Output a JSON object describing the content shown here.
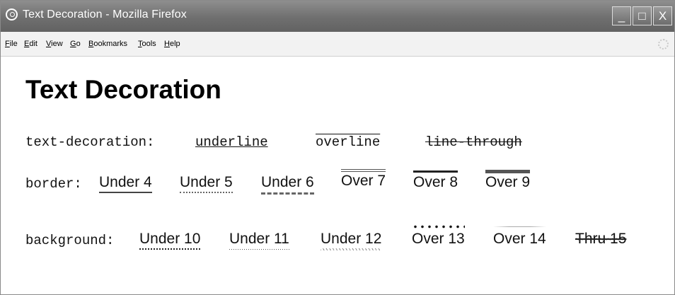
{
  "window": {
    "title": "Text Decoration - Mozilla Firefox",
    "buttons": {
      "minimize": "_",
      "maximize": "□",
      "close": "X"
    }
  },
  "menu": [
    {
      "label": "File",
      "accel": "F",
      "rest": "ile"
    },
    {
      "label": "Edit",
      "accel": "E",
      "rest": "dit"
    },
    {
      "label": "View",
      "accel": "V",
      "rest": "iew"
    },
    {
      "label": "Go",
      "accel": "G",
      "rest": "o"
    },
    {
      "label": "Bookmarks",
      "accel": "B",
      "rest": "ookmarks"
    },
    {
      "label": "Tools",
      "accel": "T",
      "rest": "ools"
    },
    {
      "label": "Help",
      "accel": "H",
      "rest": "elp"
    }
  ],
  "page": {
    "heading": "Text Decoration",
    "row1": {
      "label": "text-decoration:",
      "items": [
        "underline",
        "overline",
        "line-through"
      ]
    },
    "row2": {
      "label": "border:",
      "items": [
        "Under 4",
        "Under 5",
        "Under 6",
        "Over 7",
        "Over 8",
        "Over 9"
      ]
    },
    "row3": {
      "label": "background:",
      "items": [
        "Under 10",
        "Under 11",
        "Under 12",
        "Over 13",
        "Over 14",
        "Thru 15"
      ]
    }
  }
}
